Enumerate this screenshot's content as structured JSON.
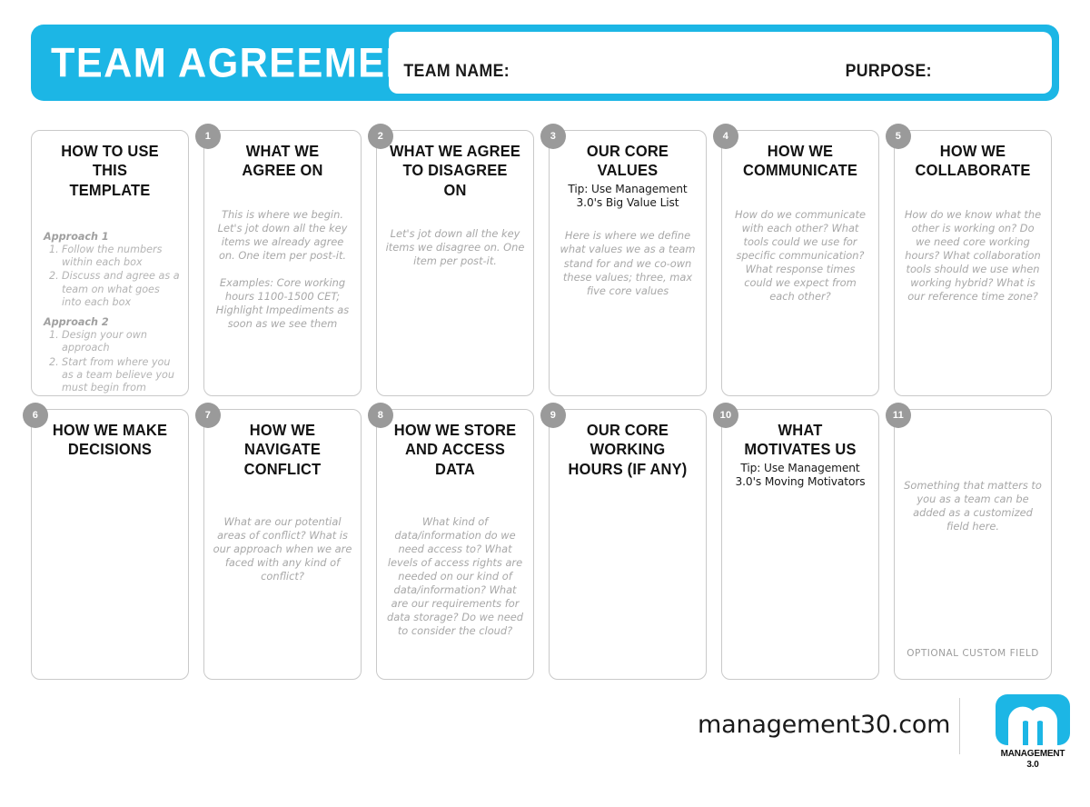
{
  "header": {
    "title": "TEAM AGREEMENT",
    "team_name_label": "TEAM NAME:",
    "purpose_label": "PURPOSE:",
    "accent_color": "#1cb6e5"
  },
  "howto": {
    "title": "HOW TO USE THIS\nTEMPLATE",
    "approaches": [
      {
        "heading": "Approach 1",
        "steps": [
          {
            "num": "1.",
            "text": "Follow the numbers within each box"
          },
          {
            "num": "2.",
            "text": "Discuss and agree as a team on what goes into each box"
          }
        ]
      },
      {
        "heading": "Approach 2",
        "steps": [
          {
            "num": "1.",
            "text": "Design your own approach"
          },
          {
            "num": "2.",
            "text": "Start from where you as a team believe you must begin from"
          }
        ]
      }
    ]
  },
  "cards": [
    {
      "number": "1",
      "title": "WHAT WE\nAGREE ON",
      "tip": "",
      "body": "This is where we begin. Let's jot down all the key items we already agree on. One item per post-it.\n\nExamples: Core working hours 1100-1500 CET; Highlight Impediments as soon as we see them",
      "footnote": ""
    },
    {
      "number": "2",
      "title": "WHAT WE AGREE\nTO DISAGREE ON",
      "tip": "",
      "body": "Let's jot down all the key items we  disagree on. One item per post-it.",
      "footnote": ""
    },
    {
      "number": "3",
      "title": "OUR CORE VALUES",
      "tip": "Tip: Use Management\n3.0's Big Value List",
      "body": "Here is where we define what values we as a team stand for and we co-own these values; three, max five core values",
      "footnote": ""
    },
    {
      "number": "4",
      "title": "HOW WE\nCOMMUNICATE",
      "tip": "",
      "body": "How do we communicate with each other? What tools could we use for specific communication? What response times could we expect from each other?",
      "footnote": ""
    },
    {
      "number": "5",
      "title": "HOW WE\nCOLLABORATE",
      "tip": "",
      "body": "How do we know what the other is working on? Do we need core working hours? What collaboration tools should we use when working hybrid? What is our reference time zone?",
      "footnote": ""
    },
    {
      "number": "6",
      "title": "HOW WE MAKE\nDECISIONS",
      "tip": "",
      "body": "",
      "footnote": ""
    },
    {
      "number": "7",
      "title": "HOW WE\nNAVIGATE CONFLICT",
      "tip": "",
      "body": "What are our potential areas of conflict? What is our approach when we are faced with any kind of conflict?",
      "footnote": ""
    },
    {
      "number": "8",
      "title": "HOW WE STORE\nAND ACCESS DATA",
      "tip": "",
      "body": "What kind of data/information do we need access to? What levels of access rights are needed on our kind of data/information? What are our requirements for data storage? Do we need to consider the cloud?",
      "footnote": ""
    },
    {
      "number": "9",
      "title": "OUR CORE WORKING\nHOURS (IF ANY)",
      "tip": "",
      "body": "",
      "footnote": ""
    },
    {
      "number": "10",
      "title": "WHAT MOTIVATES US",
      "tip": "Tip: Use Management\n3.0's Moving Motivators",
      "body": "",
      "footnote": ""
    },
    {
      "number": "11",
      "title": "",
      "tip": "",
      "body": "Something that matters to you as a team can be added as a customized field here.",
      "footnote": "OPTIONAL CUSTOM FIELD"
    }
  ],
  "footer": {
    "url": "management30.com",
    "logo_wordmark": "MANAGEMENT 3.0",
    "logo_color": "#1cb6e5"
  }
}
